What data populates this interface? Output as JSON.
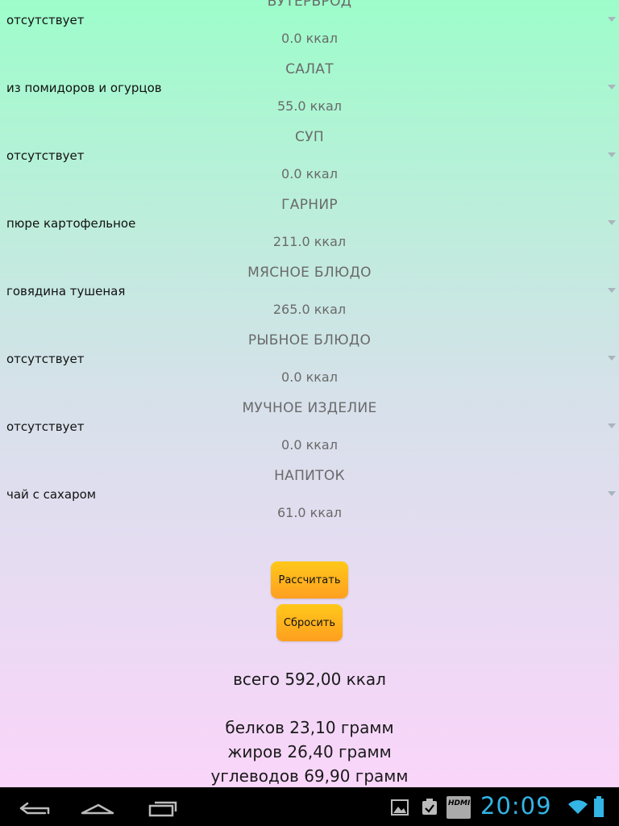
{
  "partial_header": "БУТЕРБРОД",
  "sections": [
    {
      "title": "БУТЕРБРОД",
      "selected": "отсутствует",
      "kcal": "0.0 ккал"
    },
    {
      "title": "САЛАТ",
      "selected": "из помидоров и огурцов",
      "kcal": "55.0 ккал"
    },
    {
      "title": "СУП",
      "selected": "отсутствует",
      "kcal": "0.0 ккал"
    },
    {
      "title": "ГАРНИР",
      "selected": "пюре картофельное",
      "kcal": "211.0 ккал"
    },
    {
      "title": "МЯСНОЕ БЛЮДО",
      "selected": "говядина тушеная",
      "kcal": "265.0 ккал"
    },
    {
      "title": "РЫБНОЕ БЛЮДО",
      "selected": "отсутствует",
      "kcal": "0.0 ккал"
    },
    {
      "title": "МУЧНОЕ ИЗДЕЛИЕ",
      "selected": "отсутствует",
      "kcal": "0.0 ккал"
    },
    {
      "title": "НАПИТОК",
      "selected": "чай с сахаром",
      "kcal": "61.0 ккал"
    }
  ],
  "buttons": {
    "calculate": "Рассчитать",
    "reset": "Сбросить"
  },
  "results": {
    "total": "всего 592,00 ккал",
    "proteins": "белков 23,10 грамм",
    "fats": "жиров 26,40 грамм",
    "carbs": "углеводов 69,90 грамм"
  },
  "statusbar": {
    "time": "20:09",
    "hdmi_label": "HDMI"
  },
  "colors": {
    "button_top": "#ffc81a",
    "button_bottom": "#ff9f20",
    "clock": "#33b5e5"
  }
}
